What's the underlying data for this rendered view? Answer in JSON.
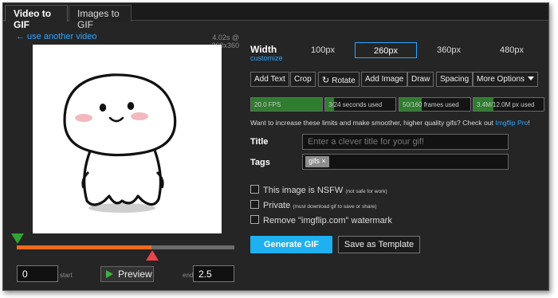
{
  "tabs": {
    "active": "Video to GIF",
    "inactive": "Images to GIF"
  },
  "source": {
    "link_label": "← use another video",
    "meta": "4.02s @ 360x360"
  },
  "timeline": {
    "start_value": "0",
    "start_label": "start",
    "end_value": "2.5",
    "end_label": "end",
    "preview_label": "Preview",
    "selected_fraction": 0.62
  },
  "width": {
    "label": "Width",
    "customize": "customize",
    "options": [
      "100px",
      "260px",
      "360px",
      "480px"
    ],
    "selected": "260px"
  },
  "tools": {
    "add_text": "Add Text",
    "crop": "Crop",
    "rotate": "Rotate",
    "add_image": "Add Image",
    "draw": "Draw",
    "spacing": "Spacing",
    "more": "More Options"
  },
  "limits": {
    "fps": "20.0 FPS",
    "fps_fill": 1.0,
    "seconds": "3/24 seconds used",
    "seconds_fill": 0.125,
    "frames": "50/160 frames used",
    "frames_fill": 0.31,
    "pixels": "3.4M/12.0M px used",
    "pixels_fill": 0.28
  },
  "upsell": {
    "text": "Want to increase these limits and make smoother, higher quality gifs? Check out ",
    "link": "Imgflip Pro",
    "suffix": "!"
  },
  "form": {
    "title_label": "Title",
    "title_placeholder": "Enter a clever title for your gif!",
    "tags_label": "Tags",
    "tag_chip": "gifs ×"
  },
  "options": {
    "nsfw": "This image is NSFW",
    "nsfw_note": "(not safe for work)",
    "private": "Private",
    "private_note": "(must download gif to save or share)",
    "watermark": "Remove \"imgflip.com\" watermark"
  },
  "actions": {
    "generate": "Generate GIF",
    "template": "Save as Template"
  },
  "colors": {
    "accent": "#1fb0f0",
    "link": "#2fa6ff",
    "fps_bar": "#2f7d2f",
    "timeline": "#ee6a1e"
  },
  "icons": {
    "rotate": "rotate-icon",
    "play": "play-icon",
    "caret": "caret-down-icon"
  }
}
